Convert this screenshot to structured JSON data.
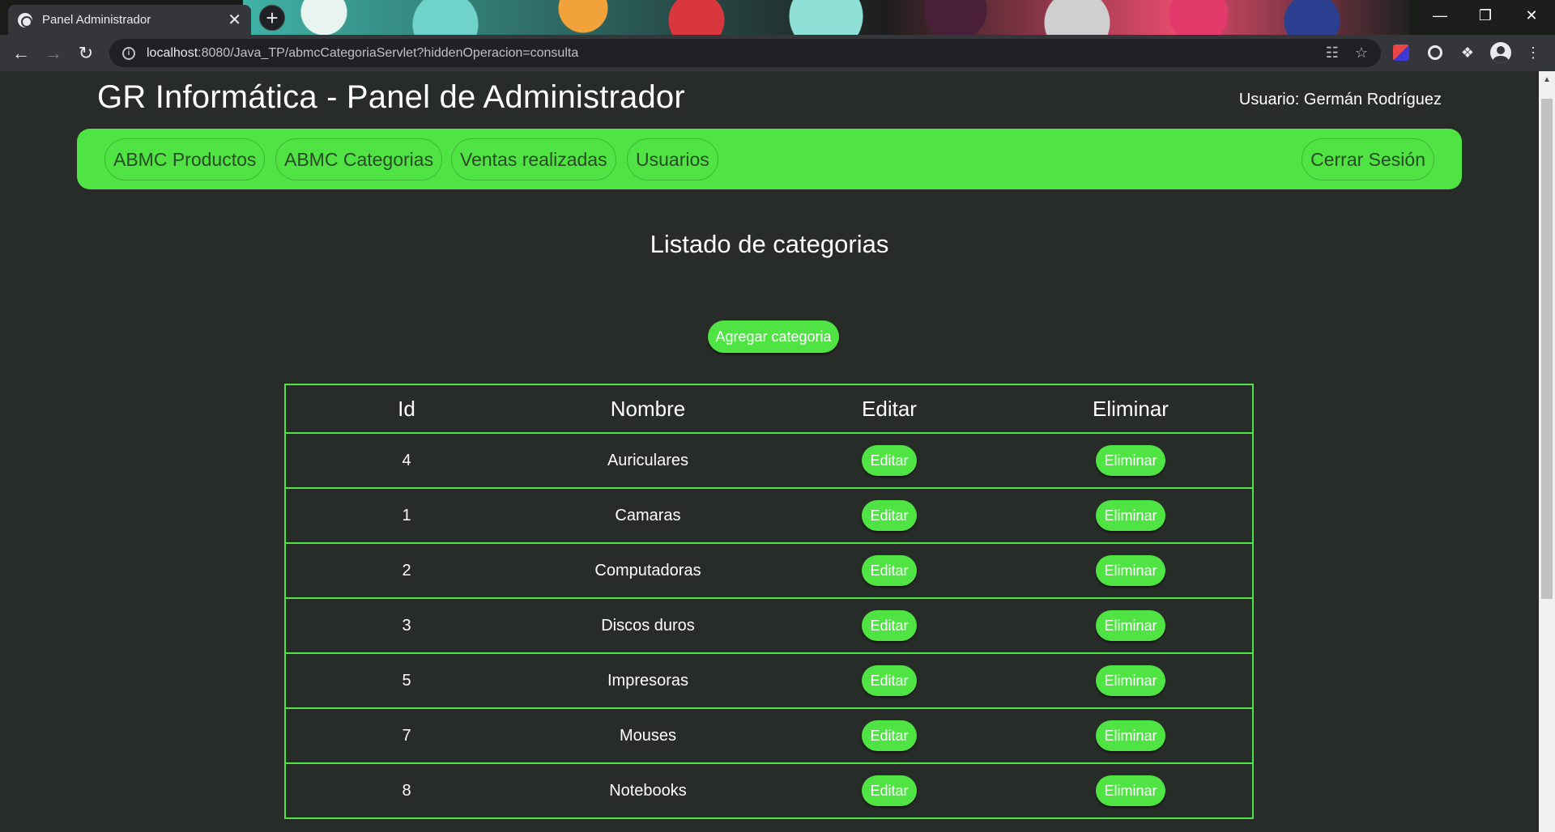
{
  "browser": {
    "tab_title": "Panel Administrador",
    "url_host": "localhost",
    "url_rest": ":8080/Java_TP/abmcCategoriaServlet?hiddenOperacion=consulta"
  },
  "header": {
    "title": "GR Informática - Panel de Administrador",
    "user": "Usuario: Germán Rodríguez"
  },
  "nav": {
    "items": [
      "ABMC Productos",
      "ABMC Categorias",
      "Ventas realizadas",
      "Usuarios"
    ],
    "logout": "Cerrar Sesión"
  },
  "main": {
    "title": "Listado de categorias",
    "add_button": "Agregar categoria"
  },
  "table": {
    "columns": [
      "Id",
      "Nombre",
      "Editar",
      "Eliminar"
    ],
    "edit_label": "Editar",
    "delete_label": "Eliminar",
    "rows": [
      {
        "id": "4",
        "name": "Auriculares"
      },
      {
        "id": "1",
        "name": "Camaras"
      },
      {
        "id": "2",
        "name": "Computadoras"
      },
      {
        "id": "3",
        "name": "Discos duros"
      },
      {
        "id": "5",
        "name": "Impresoras"
      },
      {
        "id": "7",
        "name": "Mouses"
      },
      {
        "id": "8",
        "name": "Notebooks"
      }
    ]
  },
  "colors": {
    "accent": "#4fe443",
    "background": "#272c28"
  }
}
